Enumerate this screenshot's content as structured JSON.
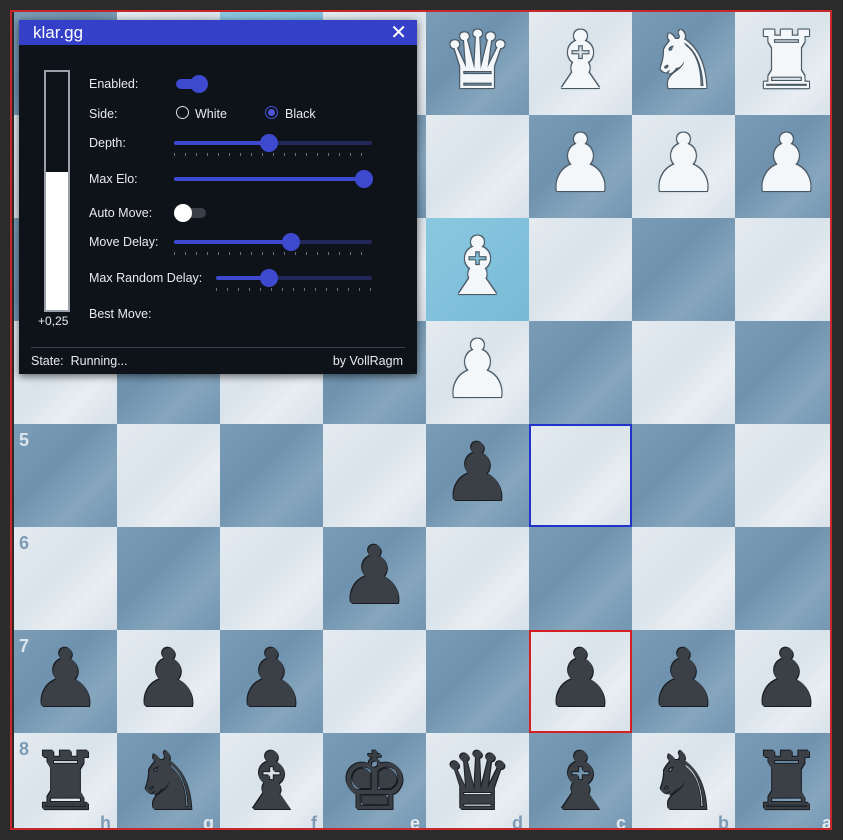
{
  "panel": {
    "title": "klar.gg",
    "close_glyph": "✕",
    "eval_text": "+0,25",
    "eval_white_fraction": 0.58,
    "labels": {
      "enabled": "Enabled:",
      "side": "Side:",
      "depth": "Depth:",
      "max_elo": "Max Elo:",
      "auto_move": "Auto Move:",
      "move_delay": "Move Delay:",
      "max_random_delay": "Max Random Delay:",
      "best_move": "Best Move:"
    },
    "enabled": true,
    "auto_move": false,
    "side_options": [
      "White",
      "Black"
    ],
    "side_selected": "Black",
    "depth_fraction": 0.48,
    "max_elo_fraction": 1.0,
    "move_delay_fraction": 0.59,
    "max_random_delay_fraction": 0.34,
    "best_move": "",
    "state_label": "State:",
    "state_value": "Running...",
    "credit": "by VollRagm",
    "accent_color": "#3d4ad0"
  },
  "board": {
    "orientation": "black",
    "rank_labels": [
      "5",
      "6",
      "7",
      "8"
    ],
    "file_labels": [
      "h",
      "g",
      "f",
      "e",
      "d",
      "c",
      "b",
      "a"
    ],
    "rows": [
      [
        "",
        "",
        "",
        "",
        "wQ",
        "wB",
        "wN",
        "wR"
      ],
      [
        "",
        "",
        "",
        "",
        "",
        "wP",
        "wP",
        "wP"
      ],
      [
        "",
        "",
        "",
        "",
        "wB",
        "",
        "",
        ""
      ],
      [
        "",
        "",
        "",
        "",
        "wP",
        "",
        "",
        ""
      ],
      [
        "",
        "",
        "",
        "",
        "bP",
        "",
        "",
        ""
      ],
      [
        "",
        "",
        "",
        "bP",
        "",
        "",
        "",
        ""
      ],
      [
        "bP",
        "bP",
        "bP",
        "",
        "",
        "bP",
        "bP",
        "bP"
      ],
      [
        "bR",
        "bN",
        "bB",
        "bK",
        "bQ",
        "bB",
        "bN",
        "bR"
      ]
    ],
    "highlight_last_move": [
      [
        0,
        2
      ],
      [
        2,
        4
      ]
    ],
    "marked_blue": [
      4,
      5
    ],
    "marked_red": [
      6,
      5
    ]
  }
}
